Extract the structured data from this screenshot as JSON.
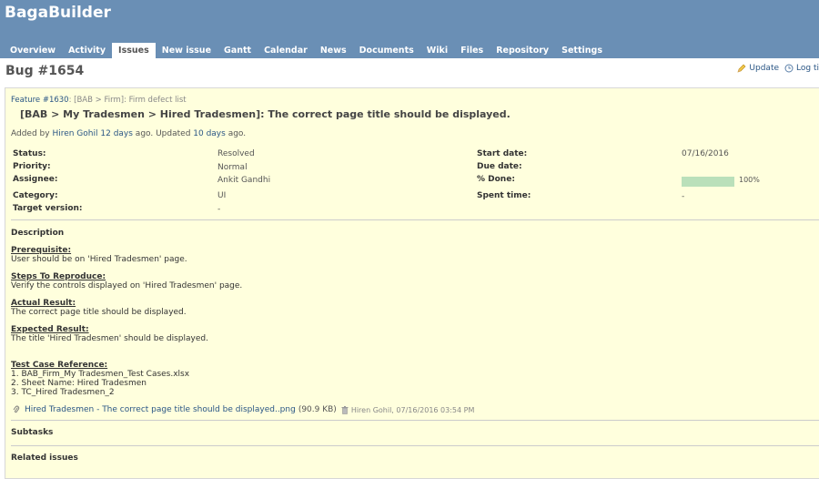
{
  "app": {
    "title": "BagaBuilder"
  },
  "menu": [
    {
      "label": "Overview",
      "selected": false
    },
    {
      "label": "Activity",
      "selected": false
    },
    {
      "label": "Issues",
      "selected": true
    },
    {
      "label": "New issue",
      "selected": false
    },
    {
      "label": "Gantt",
      "selected": false
    },
    {
      "label": "Calendar",
      "selected": false
    },
    {
      "label": "News",
      "selected": false
    },
    {
      "label": "Documents",
      "selected": false
    },
    {
      "label": "Wiki",
      "selected": false
    },
    {
      "label": "Files",
      "selected": false
    },
    {
      "label": "Repository",
      "selected": false
    },
    {
      "label": "Settings",
      "selected": false
    }
  ],
  "contextual": {
    "update_label": "Update",
    "log_time_label": "Log ti"
  },
  "page": {
    "title": "Bug #1654"
  },
  "issue": {
    "parent_link": "Feature #1630",
    "parent_subject": ": [BAB > Firm]: Firm defect list",
    "subject": "[BAB > My Tradesmen > Hired Tradesmen]: The correct page title should be displayed.",
    "added_by_prefix": "Added by ",
    "author": "Hiren Gohil",
    "created_ago": "12 days",
    "ago_updated": " ago. Updated ",
    "updated_ago": "10 days",
    "ago_end": " ago.",
    "attributes": {
      "status_label": "Status:",
      "status_value": "Resolved",
      "priority_label": "Priority:",
      "priority_value": "Normal",
      "assignee_label": "Assignee:",
      "assignee_value": "Ankit Gandhi",
      "category_label": "Category:",
      "category_value": "UI",
      "target_label": "Target version:",
      "target_value": "-",
      "start_label": "Start date:",
      "start_value": "07/16/2016",
      "due_label": "Due date:",
      "due_value": "",
      "done_label": "% Done:",
      "done_value": "100%",
      "done_fraction": 1.0,
      "spent_label": "Spent time:",
      "spent_value": "-"
    },
    "description": {
      "heading": "Description",
      "prerequisite_title": "Prerequisite:",
      "prerequisite_text": "User should be on 'Hired Tradesmen' page.",
      "steps_title": "Steps To Reproduce:",
      "steps_text": "Verify the controls displayed on 'Hired Tradesmen' page.",
      "actual_title": "Actual Result:",
      "actual_text": "The correct page title should be displayed.",
      "expected_title": "Expected Result:",
      "expected_text": "The title 'Hired Tradesmen' should be displayed.",
      "testcase_title": "Test Case Reference:",
      "testcase_lines": [
        "1. BAB_Firm_My Tradesmen_Test Cases.xlsx",
        "2. Sheet Name: Hired Tradesmen",
        "3. TC_Hired Tradesmen_2"
      ]
    },
    "attachment": {
      "filename": "Hired Tradesmen - The correct page title should be displayed..png",
      "size": "(90.9 KB)",
      "meta": "Hiren Gohil, 07/16/2016 03:54 PM"
    },
    "subtasks_heading": "Subtasks",
    "related_heading": "Related issues"
  },
  "colors": {
    "header_bg": "#6a8fb5",
    "issue_bg": "#ffffdd",
    "link": "#2a5685",
    "progress_fill": "#bae0ba"
  }
}
